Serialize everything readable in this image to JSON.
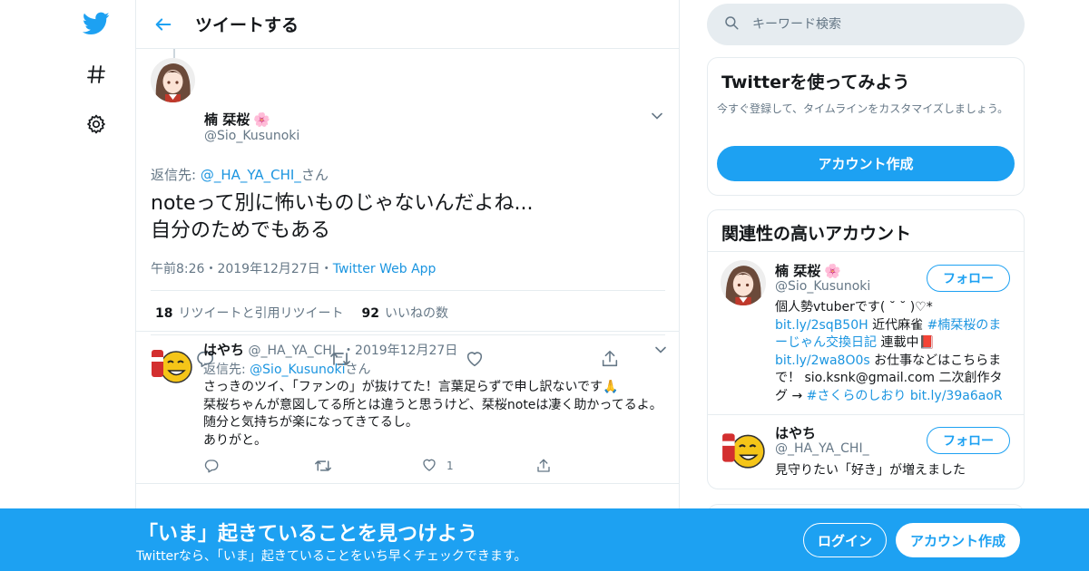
{
  "nav": {
    "items": [
      {
        "icon": "twitter-bird-icon"
      },
      {
        "icon": "hashtag-icon"
      },
      {
        "icon": "settings-gear-icon"
      }
    ]
  },
  "header": {
    "title": "ツイートする"
  },
  "tweet": {
    "name": "楠 栞桜",
    "name_emoji": "🌸",
    "handle": "@Sio_Kusunoki",
    "reply_to_label": "返信先: ",
    "reply_to_handle": "@_HA_YA_CHI_",
    "reply_to_suffix": "さん",
    "text_line1": "noteって別に怖いものじゃないんだよね...",
    "text_line2": "自分のためでもある",
    "time": "午前8:26",
    "sep1": "・",
    "date": "2019年12月27日",
    "sep2": "・",
    "source": "Twitter Web App",
    "retweets_count": "18",
    "retweets_label": "リツイートと引用リツイート",
    "likes_count": "92",
    "likes_label": "いいねの数"
  },
  "reply": {
    "name": "はやち",
    "handle": "@_HA_YA_CHI_",
    "sep": "・",
    "date": "2019年12月27日",
    "reply_to_label": "返信先: ",
    "reply_to_handle": "@Sio_Kusunoki",
    "reply_to_suffix": "さん",
    "line1": "さっきのツイ、「ファンの」が抜けてた！言葉足らずで申し訳ないです🙏",
    "line2": "栞桜ちゃんが意図してる所とは違うと思うけど、栞桜noteは凄く助かってるよ。随分と気持ちが楽になってきてるし。",
    "line3": "ありがと。",
    "like_count": "1"
  },
  "search": {
    "placeholder": "キーワード検索"
  },
  "signup_card": {
    "title": "Twitterを使ってみよう",
    "description": "今すぐ登録して、タイムラインをカスタマイズしましょう。",
    "button": "アカウント作成"
  },
  "related": {
    "title": "関連性の高いアカウント",
    "accounts": [
      {
        "name": "楠 栞桜",
        "name_emoji": "🌸",
        "handle": "@Sio_Kusunoki",
        "follow": "フォロー",
        "bio_1": "個人勢vtuberです( ˘ ˘ )♡*",
        "bio_link1": "bit.ly/2sqB50H",
        "bio_2": " 近代麻雀 ",
        "bio_hashtag1": "#楠栞桜のまーじゃん交換日記",
        "bio_3": " 連載中📕",
        "bio_link2": "bit.ly/2wa8O0s",
        "bio_4": " お仕事などはこちらまで！ sio.ksnk@gmail.com 二次創作タグ → ",
        "bio_hashtag2": "#さくらのしおり",
        "bio_5": " ",
        "bio_link3": "bit.ly/39a6aoR"
      },
      {
        "name": "はやち",
        "handle": "@_HA_YA_CHI_",
        "follow": "フォロー",
        "bio": "見守りたい「好き」が増えました"
      }
    ]
  },
  "banner": {
    "title": "「いま」起きていることを見つけよう",
    "subtitle": "Twitterなら、「いま」起きていることをいち早くチェックできます。",
    "login": "ログイン",
    "signup": "アカウント作成"
  },
  "colors": {
    "accent": "#1da1f2",
    "link": "#1b95e0",
    "secondary_text": "#657786",
    "border": "#e6ecf0"
  }
}
